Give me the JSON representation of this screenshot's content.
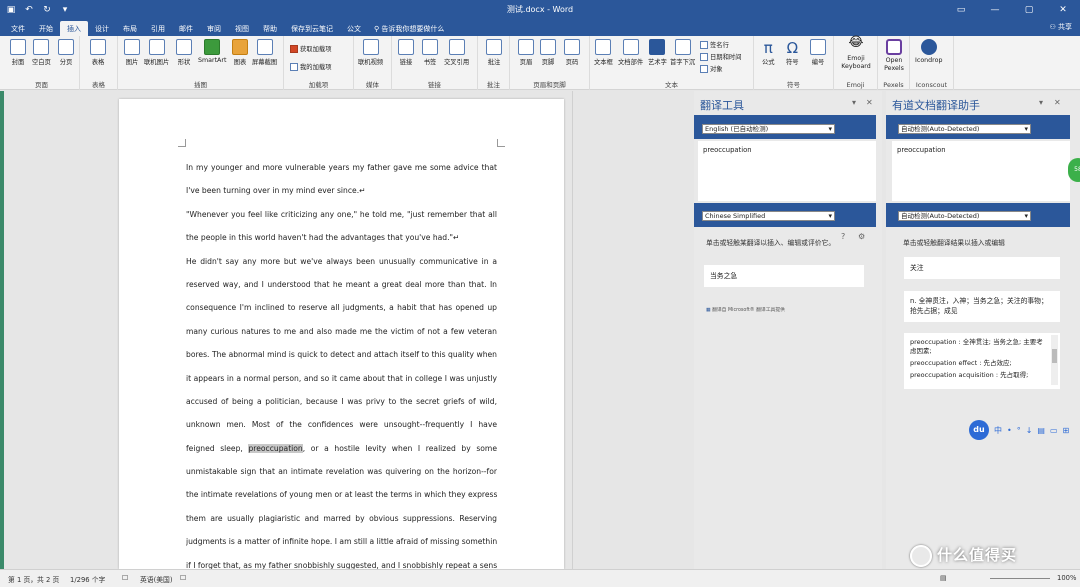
{
  "window": {
    "title": "测试.docx - Word",
    "share_label": "共享",
    "search_placeholder": "告诉我你想要做什么"
  },
  "menu_tabs": [
    "文件",
    "开始",
    "插入",
    "设计",
    "布局",
    "引用",
    "邮件",
    "审阅",
    "视图",
    "帮助",
    "保存到云笔记",
    "公文"
  ],
  "active_tab": "插入",
  "ribbon": {
    "groups": [
      {
        "label": "页面",
        "buttons": [
          "封面",
          "空白页",
          "分页"
        ]
      },
      {
        "label": "表格",
        "buttons": [
          "表格"
        ]
      },
      {
        "label": "插图",
        "buttons": [
          "图片",
          "联机图片",
          "形状",
          "SmartArt",
          "图表",
          "屏幕截图"
        ]
      },
      {
        "label": "加载项",
        "buttons": [
          "获取加载项",
          "我的加载项"
        ]
      },
      {
        "label": "媒体",
        "buttons": [
          "联机视频"
        ]
      },
      {
        "label": "链接",
        "buttons": [
          "链接",
          "书签",
          "交叉引用"
        ]
      },
      {
        "label": "批注",
        "buttons": [
          "批注"
        ]
      },
      {
        "label": "页眉和页脚",
        "buttons": [
          "页眉",
          "页脚",
          "页码"
        ]
      },
      {
        "label": "文本",
        "buttons": [
          "文本框",
          "文档部件",
          "艺术字",
          "首字下沉",
          "签名行",
          "日期和时间",
          "对象"
        ]
      },
      {
        "label": "符号",
        "buttons": [
          "公式",
          "符号",
          "编号"
        ]
      },
      {
        "label": "Emoji",
        "buttons": [
          "Emoji Keyboard"
        ]
      },
      {
        "label": "Pexels",
        "buttons": [
          "Open Pexels"
        ]
      },
      {
        "label": "Iconscout",
        "buttons": [
          "Icondrop"
        ]
      }
    ]
  },
  "document": {
    "lines": [
      "In my younger and more vulnerable years my father gave me some advice that",
      "I've been turning over in my mind ever since.↵",
      "\"Whenever you feel like criticizing any one,\" he told me, \"just remember that all",
      "the people in this world haven't had the advantages that you've had.\"↵",
      "He didn't say any more but we've always been unusually communicative in a",
      "reserved way, and I understood that he meant a great deal more than that. In",
      "consequence I'm inclined to reserve all judgments, a habit that has opened up",
      "many curious natures to me and also made me the victim of not a few veteran",
      "bores. The abnormal mind is quick to detect and attach itself to this quality when",
      "it appears in a normal person, and so it came about that in college I was unjustly",
      "accused of being a politician, because I was privy to the secret griefs of wild,",
      "unknown men. Most of the confidences were unsought--frequently I have",
      "feigned sleep, ",
      "unmistakable sign that an intimate revelation was quivering on the horizon--for",
      "the intimate revelations of young men or at least the terms in which they express",
      "them are usually plagiaristic and marred by obvious suppressions. Reserving",
      "judgments is a matter of infinite hope. I am still a little afraid of missing something",
      "if I forget that, as my father snobbishly suggested, and I snobbishly repeat a sense"
    ],
    "highlight_word": "preoccupation",
    "line13_after": ", or a hostile levity when I realized by some"
  },
  "translator_pane": {
    "title": "翻译工具",
    "source_lang": "English (已自动检测)",
    "source_text": "preoccupation",
    "target_lang": "Chinese Simplified",
    "hint": "单击或轻触某翻译以插入、编辑或评价它。",
    "result": "当务之急",
    "footer": "翻译自 Microsoft® 翻译工具提供"
  },
  "youdao_pane": {
    "title": "有道文档翻译助手",
    "source_lang": "自动检测(Auto-Detected)",
    "source_text": "preoccupation",
    "target_lang": "自动检测(Auto-Detected)",
    "hint": "单击或轻触翻译结果以插入或编辑",
    "result1": "关注",
    "result2": "n. 全神贯注，入神；当务之急；关注的事物；抢先占据；成见",
    "dict_lines": [
      "preoccupation : 全神贯注; 当务之急; 主要考虑因素;",
      "preoccupation effect : 先占效应;",
      "preoccupation acquisition : 先占取得;"
    ]
  },
  "statusbar": {
    "page": "第 1 页，共 2 页",
    "words": "1/296 个字",
    "language": "英语(美国)",
    "zoom": "100%"
  },
  "overlay": {
    "du_label": "du",
    "du_items": [
      "中",
      "•",
      "°",
      "↓",
      "▤",
      "▭",
      "⊞"
    ],
    "watermark": "什么值得买"
  }
}
